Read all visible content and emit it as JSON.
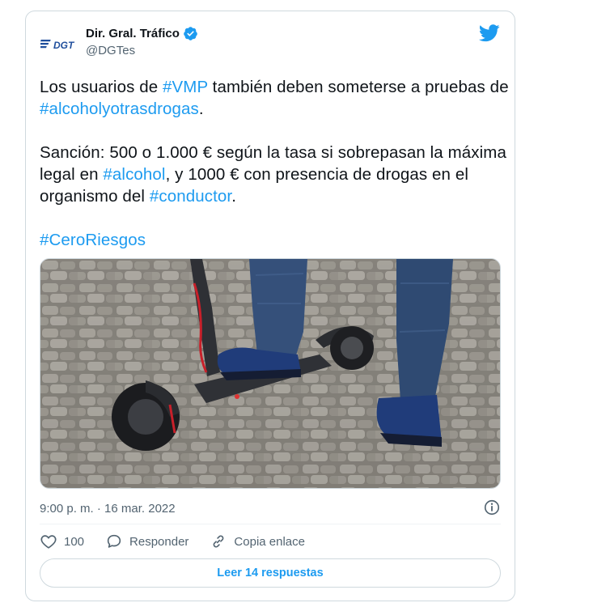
{
  "account": {
    "display_name": "Dir. Gral. Tráfico",
    "handle": "@DGTes",
    "logo_text": "DGT",
    "verified_icon": "verified-badge-icon"
  },
  "tweet": {
    "line1_a": "Los usuarios de ",
    "tag_vmp": "#VMP",
    "line1_b": " también deben someterse a pruebas de ",
    "tag_alcohol_drogas": "#alcoholyotrasdrogas",
    "line1_c": ".",
    "line2_a": "Sanción: 500 o 1.000 € según la tasa si sobrepasan la máxima legal en ",
    "tag_alcohol": "#alcohol",
    "line2_b": ", y 1000 € con presencia de drogas en el organismo del ",
    "tag_conductor": "#conductor",
    "line2_c": ".",
    "tag_ceroriesgos": "#CeroRiesgos"
  },
  "meta": {
    "timestamp": "9:00 p. m. · 16 mar. 2022"
  },
  "actions": {
    "likes": "100",
    "reply_label": "Responder",
    "copy_label": "Copia enlace"
  },
  "replies_button": "Leer 14 respuestas",
  "colors": {
    "link": "#1d9bf0",
    "text": "#0f1419",
    "muted": "#536471",
    "border": "#cfd9de",
    "logo_blue": "#1f4e9c"
  }
}
